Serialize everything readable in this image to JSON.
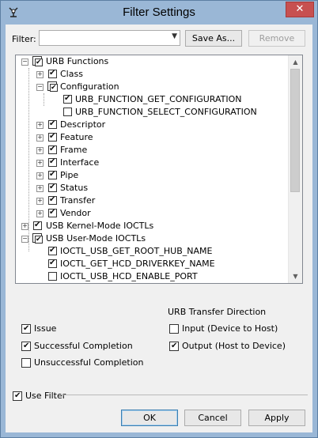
{
  "window": {
    "title": "Filter Settings",
    "close_label": "✕"
  },
  "filter": {
    "label": "Filter:",
    "value": ""
  },
  "buttons": {
    "save_as": "Save As...",
    "remove": "Remove",
    "ok": "OK",
    "cancel": "Cancel",
    "apply": "Apply"
  },
  "tree": {
    "rows": [
      {
        "label": "URB Functions"
      },
      {
        "label": "Class"
      },
      {
        "label": "Configuration"
      },
      {
        "label": "URB_FUNCTION_GET_CONFIGURATION"
      },
      {
        "label": "URB_FUNCTION_SELECT_CONFIGURATION"
      },
      {
        "label": "Descriptor"
      },
      {
        "label": "Feature"
      },
      {
        "label": "Frame"
      },
      {
        "label": "Interface"
      },
      {
        "label": "Pipe"
      },
      {
        "label": "Status"
      },
      {
        "label": "Transfer"
      },
      {
        "label": "Vendor"
      },
      {
        "label": "USB Kernel-Mode IOCTLs"
      },
      {
        "label": "USB User-Mode IOCTLs"
      },
      {
        "label": "IOCTL_USB_GET_ROOT_HUB_NAME"
      },
      {
        "label": "IOCTL_GET_HCD_DRIVERKEY_NAME"
      },
      {
        "label": "IOCTL_USB_HCD_ENABLE_PORT"
      }
    ]
  },
  "options": {
    "direction_title": "URB Transfer Direction",
    "issue": "Issue",
    "successful": "Successful Completion",
    "unsuccessful": "Unsuccessful Completion",
    "input": "Input (Device to Host)",
    "output": "Output (Host to Device)",
    "use_filter": "Use Filter"
  }
}
